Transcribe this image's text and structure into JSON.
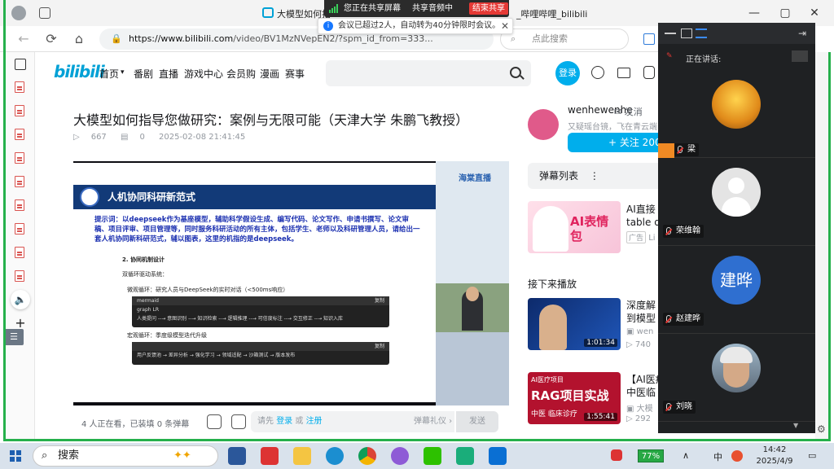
{
  "browser": {
    "tab_title": "大模型如何指",
    "tab_title_tail": "_哔哩哔哩_bilibili",
    "url_host": "https://www.bilibili.com",
    "url_path": "/video/BV1MzNVepEN2/?spm_id_from=333...",
    "search_placeholder": "点此搜索"
  },
  "share_banner": {
    "sharing_label": "您正在共享屏幕",
    "audio_label": "共享音频中",
    "stop_label": "结束共享"
  },
  "notice": {
    "text": "会议已超过2人，自动转为40分钟限时会议。"
  },
  "bili": {
    "logo": "bilibili",
    "nav": [
      "首页",
      "番剧",
      "直播",
      "游戏中心",
      "会员购",
      "漫画",
      "赛事"
    ],
    "login_label": "登录"
  },
  "video": {
    "title": "大模型如何指导您做研究：案例与无限可能（天津大学 朱鹏飞教授）",
    "plays": "667",
    "danmaku_count": "0",
    "date": "2025-02-08 21:41:45"
  },
  "slide": {
    "header": "人机协同科研新范式",
    "prompt": "提示词：以deepseek作为基座模型，辅助科学假设生成、编写代码、论文写作、申请书撰写、论文审稿、项目评审、项目管理等，同时服务科研活动的所有主体，包括学生、老师以及科研管理人员，请给出一套人机协同新科研范式，辅以图表，这里的机指的是deepseek。",
    "section": "2. 协同机制设计",
    "subsection": "双循环驱动系统：",
    "micro": "微观循环：研究人员与DeepSeek的实时对话（<500ms响应）",
    "code1_lang": "mermaid",
    "code1_copy": "复制",
    "code1_line1": "graph LR",
    "code1_line2": "人类提问 --→ 意图识别 --→ 知识检索 --→ 逻辑推理 --→ 可信度标注 --→ 交互修正 --→ 知识入库",
    "macro": "宏观循环：季度级模型迭代升级",
    "code2_copy": "复制",
    "code2_line1": "用户反馈池 → 差异分析 → 强化学习 → 领域适配 → 沙箱测试 → 版本发布",
    "brand": "海棠直播"
  },
  "danmaku_bar": {
    "viewers": "4 人正在看，已装填 0 条弹幕",
    "please": "请先",
    "login": "登录",
    "or": "或",
    "register": "注册",
    "etiquette": "弹幕礼仪 ›",
    "send": "发送"
  },
  "uploader": {
    "name": "wenhewenhe",
    "message": "发消",
    "sign": "又疑瑶台镜，飞在青云端",
    "follow": "+ 关注 200"
  },
  "right": {
    "danmaku_list": "弹幕列表",
    "ad_title_1": "AI直接",
    "ad_title_2": "table d",
    "ad_badge": "广告",
    "ad_meta": "Li",
    "ad_thumb_text": "AI表情包",
    "next_title": "接下来播放",
    "rec1_title_1": "深度解",
    "rec1_title_2": "到模型",
    "rec1_up": "wen",
    "rec1_plays": "740",
    "rec1_duration": "1:01:34",
    "rec2_title_1": "【AI医疗",
    "rec2_title_2": "中医临",
    "rec2_up": "大模",
    "rec2_plays": "292",
    "rec2_duration": "1:55:41",
    "rec2_thumb_tag": "AI医疗项目",
    "rec2_thumb_big": "RAG项目实战",
    "rec2_thumb_sub": "中医 临床诊疗"
  },
  "meeting": {
    "speaking": "正在讲话:",
    "participants": [
      {
        "name": "梁"
      },
      {
        "name": "荣维翰"
      },
      {
        "name": "赵建晔",
        "initials": "建晔"
      },
      {
        "name": "刘晓"
      }
    ]
  },
  "taskbar": {
    "search": "搜索",
    "battery": "77%",
    "ime": "中",
    "time": "14:42",
    "date": "2025/4/9"
  },
  "colors": {
    "bili_blue": "#00aeec",
    "share_green": "#26b04c",
    "stop_red": "#e53935"
  }
}
